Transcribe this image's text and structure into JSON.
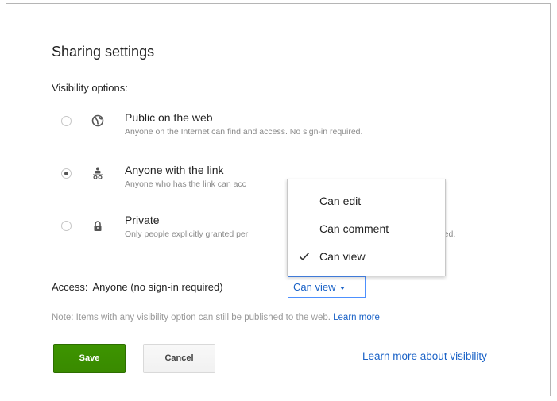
{
  "dialog": {
    "title": "Sharing settings",
    "visibility_label": "Visibility options:"
  },
  "options": [
    {
      "title": "Public on the web",
      "description": "Anyone on the Internet can find and access. No sign-in required.",
      "icon": "globe-icon",
      "selected": false
    },
    {
      "title": "Anyone with the link",
      "description": "Anyone who has the link can acc",
      "icon": "link-person-icon",
      "selected": true
    },
    {
      "title": "Private",
      "description": "Only people explicitly granted per",
      "description_tail": "uired.",
      "icon": "lock-icon",
      "selected": false
    }
  ],
  "access": {
    "label": "Access:",
    "value": "Anyone (no sign-in required)",
    "selected": "Can view"
  },
  "menu": {
    "items": [
      {
        "label": "Can edit",
        "checked": false
      },
      {
        "label": "Can comment",
        "checked": false
      },
      {
        "label": "Can view",
        "checked": true
      }
    ]
  },
  "note": {
    "text": "Note: Items with any visibility option can still be published to the web.",
    "link": "Learn more"
  },
  "buttons": {
    "save": "Save",
    "cancel": "Cancel"
  },
  "learn_visibility": "Learn more about visibility",
  "colors": {
    "save_green": "#3d9400",
    "link_blue": "#1a62c7",
    "select_border": "#4d90fe"
  }
}
